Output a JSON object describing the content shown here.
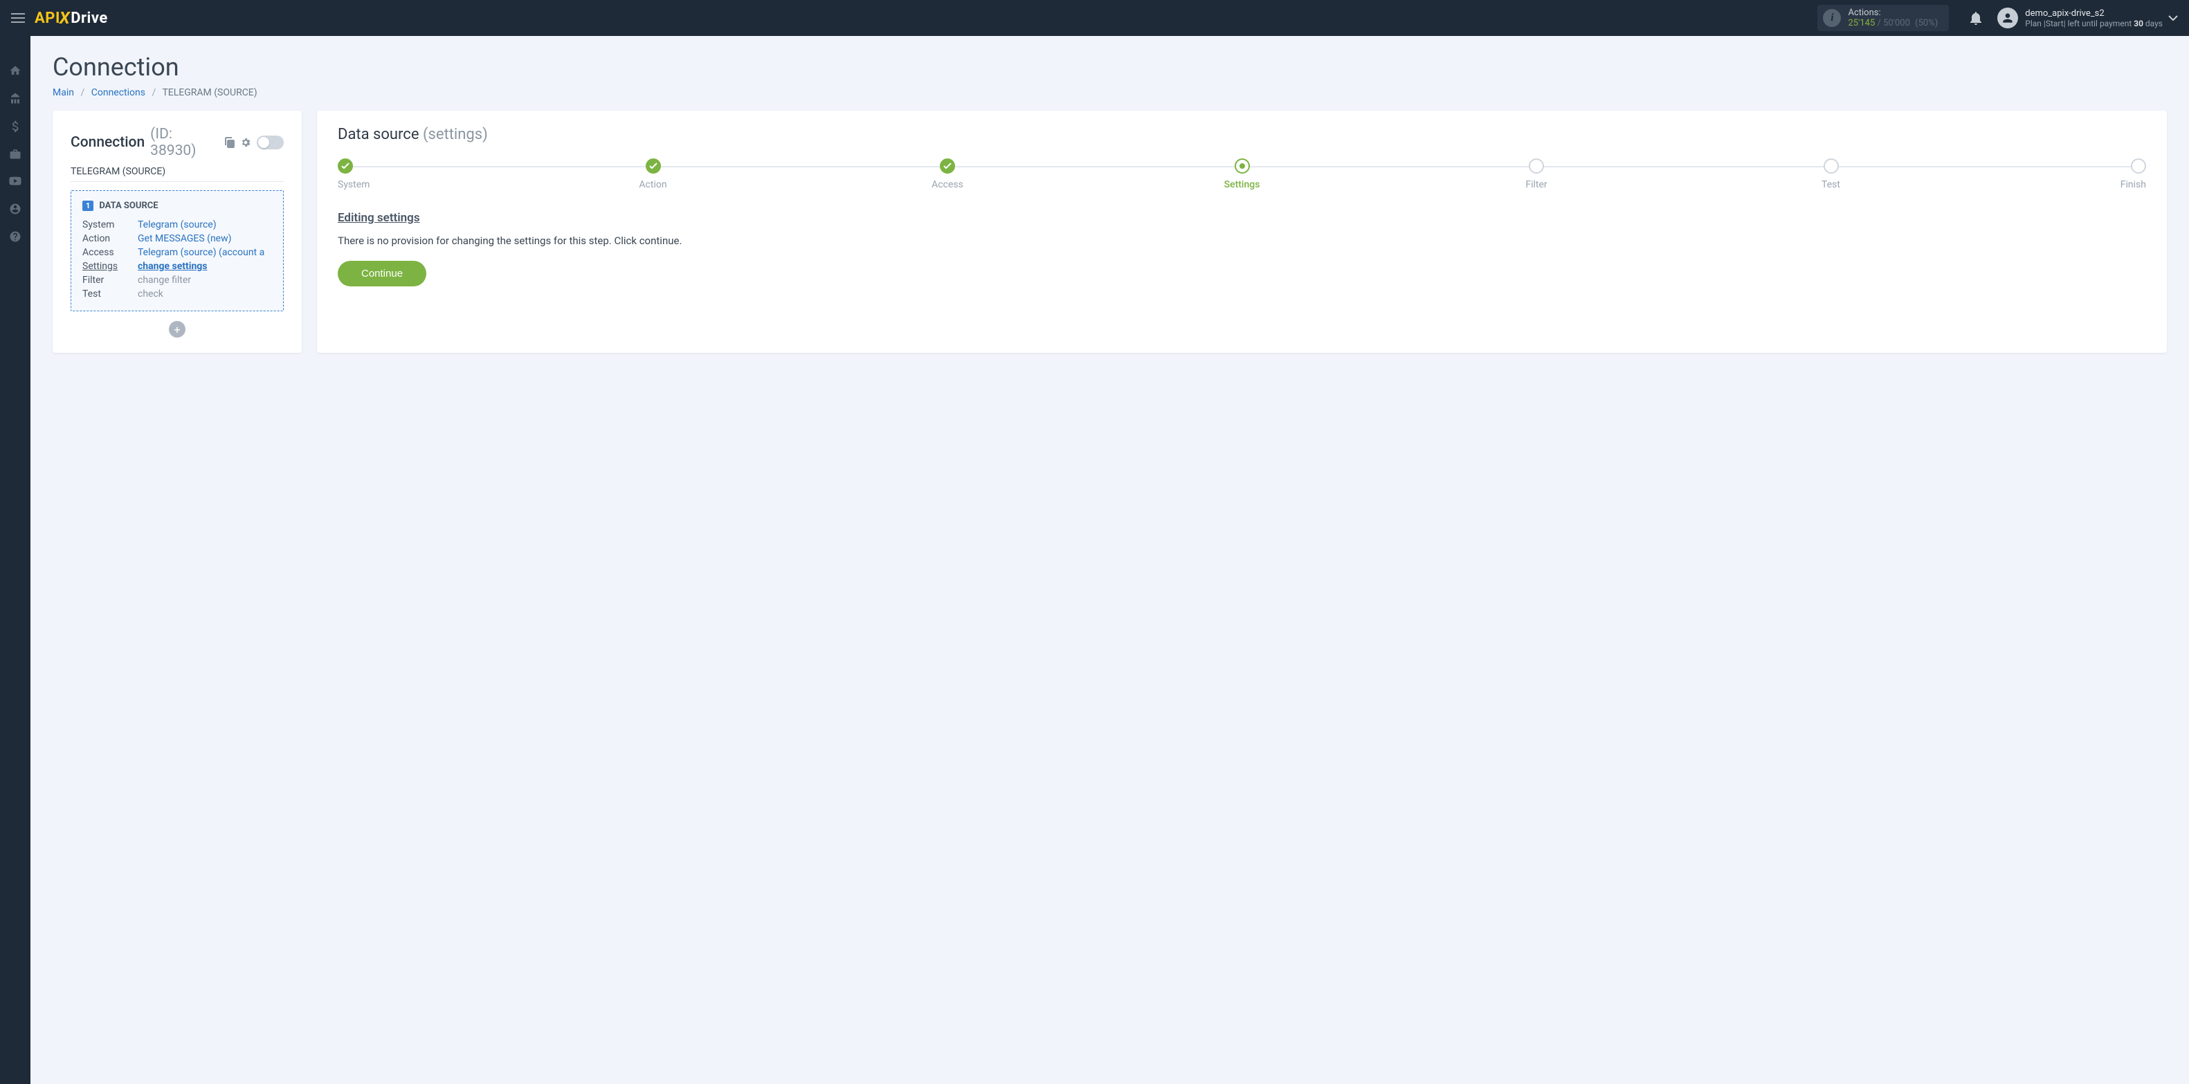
{
  "header": {
    "logo": {
      "part1": "API",
      "part2": "X",
      "part3": "Drive"
    },
    "actions": {
      "label": "Actions:",
      "current": "25'145",
      "total": "50'000",
      "percent": "(50%)"
    },
    "user": {
      "name": "demo_apix-drive_s2",
      "plan_prefix": "Plan |",
      "plan_name": "Start",
      "plan_mid": "| left until payment ",
      "days_num": "30",
      "days_suffix": " days"
    }
  },
  "page": {
    "title": "Connection",
    "breadcrumb": {
      "main": "Main",
      "connections": "Connections",
      "current": "TELEGRAM (SOURCE)"
    }
  },
  "left": {
    "conn_label": "Connection",
    "conn_id": "(ID: 38930)",
    "subtitle": "TELEGRAM (SOURCE)",
    "ds_badge": "1",
    "ds_title": "DATA SOURCE",
    "rows": {
      "system": {
        "k": "System",
        "v": "Telegram (source)"
      },
      "action": {
        "k": "Action",
        "v": "Get MESSAGES (new)"
      },
      "access": {
        "k": "Access",
        "v": "Telegram (source) (account a"
      },
      "settings": {
        "k": "Settings",
        "v": "change settings"
      },
      "filter": {
        "k": "Filter",
        "v": "change filter"
      },
      "test": {
        "k": "Test",
        "v": "check"
      }
    }
  },
  "right": {
    "title": "Data source",
    "title_gray": "(settings)",
    "steps": {
      "system": "System",
      "action": "Action",
      "access": "Access",
      "settings": "Settings",
      "filter": "Filter",
      "test": "Test",
      "finish": "Finish"
    },
    "section_title": "Editing settings",
    "section_text": "There is no provision for changing the settings for this step. Click continue.",
    "continue": "Continue"
  }
}
